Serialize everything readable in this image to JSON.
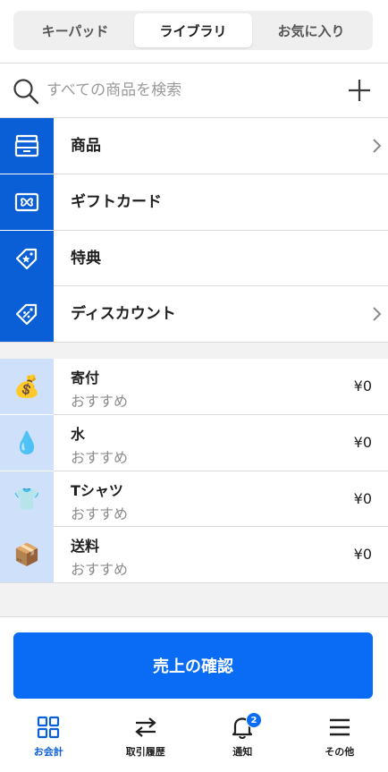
{
  "tabs": [
    {
      "label": "キーパッド",
      "active": false
    },
    {
      "label": "ライブラリ",
      "active": true
    },
    {
      "label": "お気に入り",
      "active": false
    }
  ],
  "search": {
    "placeholder": "すべての商品を検索",
    "value": ""
  },
  "categories": [
    {
      "label": "商品",
      "icon": "item-tray-icon",
      "has_chevron": true
    },
    {
      "label": "ギフトカード",
      "icon": "gift-card-icon",
      "has_chevron": false
    },
    {
      "label": "特典",
      "icon": "reward-tag-icon",
      "has_chevron": false
    },
    {
      "label": "ディスカウント",
      "icon": "discount-tag-icon",
      "has_chevron": true
    }
  ],
  "items": [
    {
      "name": "寄付",
      "subtitle": "おすすめ",
      "price": "¥0",
      "emoji": "💰"
    },
    {
      "name": "水",
      "subtitle": "おすすめ",
      "price": "¥0",
      "emoji": "💧"
    },
    {
      "name": "Tシャツ",
      "subtitle": "おすすめ",
      "price": "¥0",
      "emoji": "👕"
    },
    {
      "name": "送料",
      "subtitle": "おすすめ",
      "price": "¥0",
      "emoji": "📦"
    }
  ],
  "primary_button": {
    "label": "売上の確認"
  },
  "bottom_nav": [
    {
      "label": "お会計",
      "icon": "grid-icon",
      "active": true
    },
    {
      "label": "取引履歴",
      "icon": "swap-arrows-icon",
      "active": false
    },
    {
      "label": "通知",
      "icon": "bell-icon",
      "active": false,
      "badge": "2"
    },
    {
      "label": "その他",
      "icon": "menu-icon",
      "active": false
    }
  ],
  "colors": {
    "accent": "#0a6cf5",
    "category_icon_bg": "#0b5fd6",
    "item_icon_bg": "#cfe0fa",
    "muted_text": "#8c8c8c"
  }
}
